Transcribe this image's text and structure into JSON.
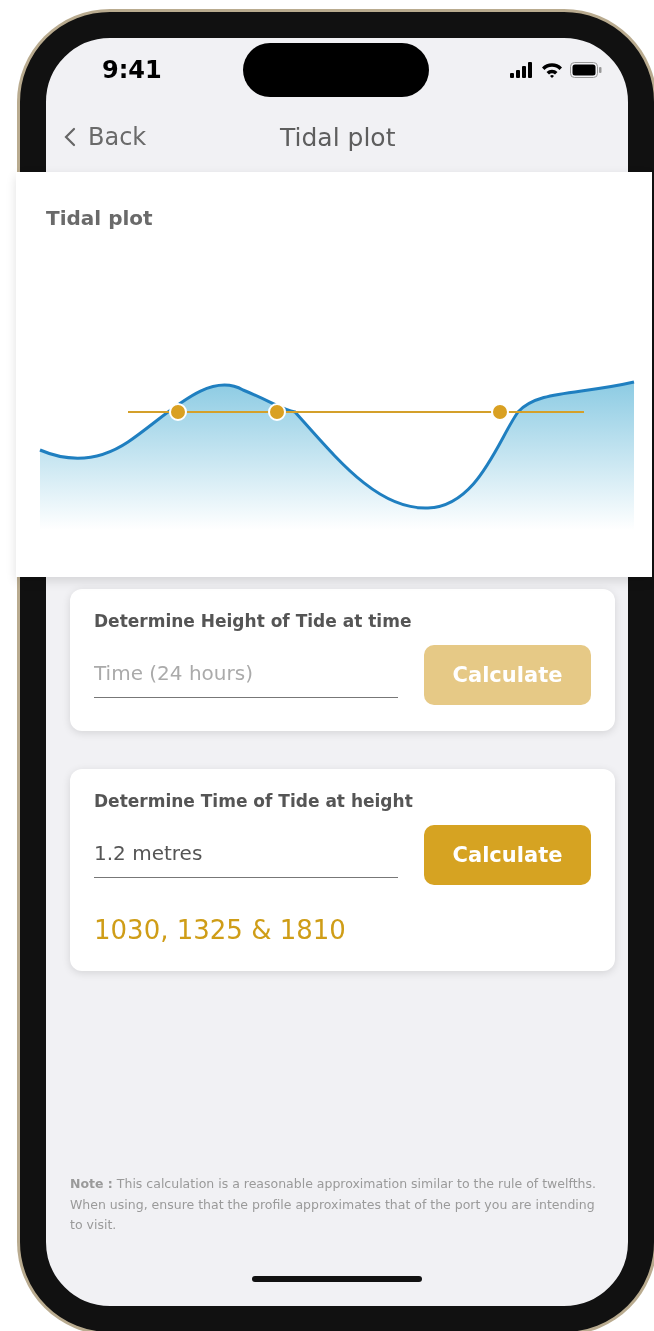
{
  "status_bar": {
    "time": "9:41"
  },
  "nav": {
    "back": "Back",
    "title": "Tidal plot"
  },
  "plot_card": {
    "title": "Tidal plot"
  },
  "calculators": [
    {
      "title": "Determine Height of Tide at time",
      "field": {
        "placeholder": "Time (24 hours)"
      },
      "button": {
        "label": "Calculate",
        "disabled": true
      }
    },
    {
      "title": "Determine Time of Tide at height",
      "field": {
        "value": "1.2 metres"
      },
      "button": {
        "label": "Calculate",
        "disabled": false
      },
      "result": "1030, 1325 & 1810"
    }
  ],
  "note": "**Note :** This calculation is a reasonable approximation similar to the rule of twelfths. When using, ensure that the profile approximates that of the port you are intending to visit."
}
